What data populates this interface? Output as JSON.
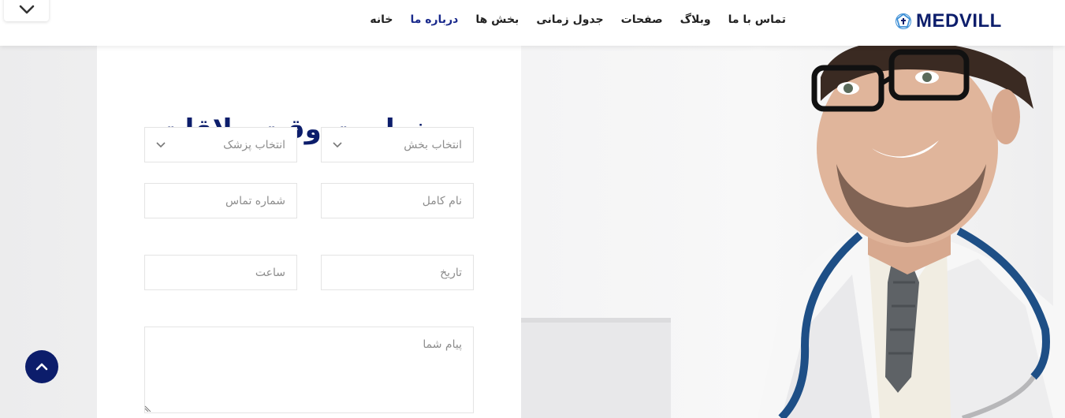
{
  "header": {
    "logo_text": "MEDVILL",
    "nav": [
      {
        "label": "خانه",
        "active": false
      },
      {
        "label": "درباره ما",
        "active": true
      },
      {
        "label": "بخش ها",
        "active": false
      },
      {
        "label": "جدول زمانی",
        "active": false
      },
      {
        "label": "صفحات",
        "active": false
      },
      {
        "label": "وبلاگ",
        "active": false
      },
      {
        "label": "تماس با ما",
        "active": false
      }
    ]
  },
  "form": {
    "title": "درخواست وقت ملاقات",
    "department_select": "انتخاب بخش",
    "doctor_select": "انتخاب پزشک",
    "name_placeholder": "نام کامل",
    "phone_placeholder": "شماره تماس",
    "date_placeholder": "تاریخ",
    "time_placeholder": "ساعت",
    "message_placeholder": "پیام شما"
  },
  "colors": {
    "brand": "#0c1d6b",
    "stethoscope": "#1e4f86"
  }
}
